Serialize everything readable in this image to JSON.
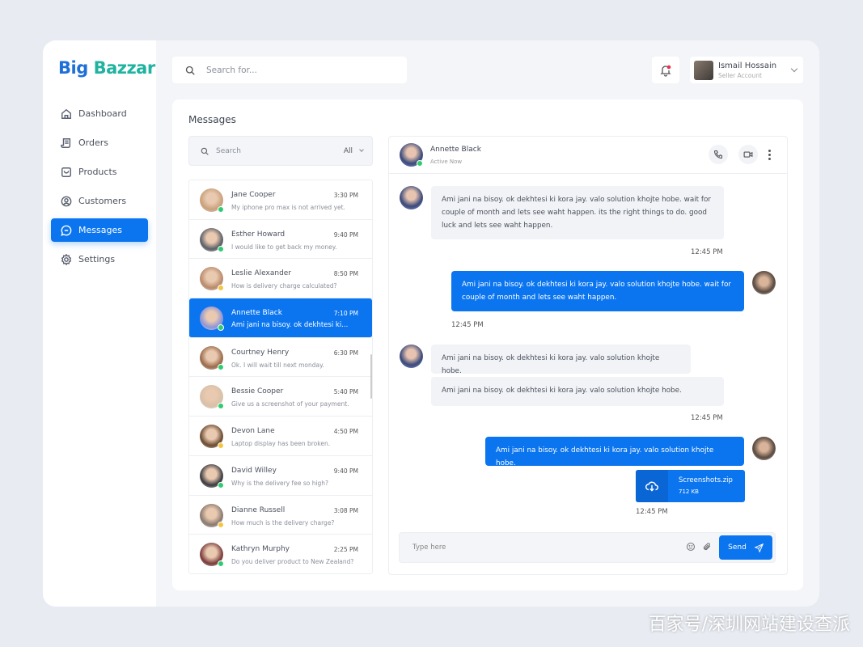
{
  "brand": {
    "part1": "Big",
    "part2": "Bazzar"
  },
  "sidebar": {
    "items": [
      {
        "label": "Dashboard",
        "icon": "home-icon"
      },
      {
        "label": "Orders",
        "icon": "receipt-icon"
      },
      {
        "label": "Products",
        "icon": "bag-icon"
      },
      {
        "label": "Customers",
        "icon": "user-circle-icon"
      },
      {
        "label": "Messages",
        "icon": "chat-icon",
        "active": true
      },
      {
        "label": "Settings",
        "icon": "gear-icon"
      }
    ]
  },
  "header": {
    "search_placeholder": "Search for...",
    "user": {
      "name": "Ismail Hossain",
      "role": "Seller Account"
    }
  },
  "messages": {
    "title": "Messages",
    "search_placeholder": "Search",
    "filter": "All",
    "conversations": [
      {
        "name": "Jane Cooper",
        "time": "3:30 PM",
        "preview": "My iphone pro max is not arrived yet.",
        "status": "online"
      },
      {
        "name": "Esther Howard",
        "time": "9:40 PM",
        "preview": "I would like to get back my money.",
        "status": "online"
      },
      {
        "name": "Leslie Alexander",
        "time": "8:50 PM",
        "preview": "How is delivery charge calculated?",
        "status": "away"
      },
      {
        "name": "Annette Black",
        "time": "7:10 PM",
        "preview": "Ami jani na bisoy. ok dekhtesi ki...",
        "status": "online",
        "active": true
      },
      {
        "name": "Courtney Henry",
        "time": "6:30 PM",
        "preview": "Ok. I will wait till next monday.",
        "status": "online"
      },
      {
        "name": "Bessie Cooper",
        "time": "5:40 PM",
        "preview": "Give us a screenshot of your payment.",
        "status": "online"
      },
      {
        "name": "Devon Lane",
        "time": "4:50 PM",
        "preview": "Laptop  display has been broken.",
        "status": "away"
      },
      {
        "name": "David Willey",
        "time": "9:40 PM",
        "preview": "Why is the delivery fee so high?",
        "status": "online"
      },
      {
        "name": "Dianne Russell",
        "time": "3:08 PM",
        "preview": "How much is the delivery charge?",
        "status": "away"
      },
      {
        "name": "Kathryn Murphy",
        "time": "2:25 PM",
        "preview": "Do you deliver product to New Zealand?",
        "status": "online"
      }
    ]
  },
  "chat": {
    "name": "Annette Black",
    "status": "Active Now",
    "messages": [
      {
        "text": "Ami jani na bisoy. ok dekhtesi ki kora jay. valo solution khojte hobe. wait for couple of month and lets see waht happen. its the right things to do. good luck and lets see waht happen."
      },
      {
        "time": "12:45 PM"
      },
      {
        "text": "Ami jani na bisoy. ok dekhtesi ki kora jay. valo solution khojte hobe. wait for couple of month and lets see waht happen."
      },
      {
        "time": "12:45 PM"
      },
      {
        "text": "Ami jani na bisoy. ok dekhtesi ki kora jay. valo solution khojte hobe."
      },
      {
        "text": "Ami jani na bisoy. ok dekhtesi ki kora jay. valo solution khojte hobe."
      },
      {
        "time": "12:45 PM"
      },
      {
        "text": "Ami jani na bisoy. ok dekhtesi ki kora jay. valo solution khojte hobe."
      },
      {
        "file": "Screenshots.zip",
        "size": "712 KB"
      },
      {
        "time": "12:45 PM"
      }
    ],
    "input_placeholder": "Type here",
    "send_label": "Send"
  },
  "colors": {
    "accent": "#0b75f0",
    "online": "#2ecc71",
    "away": "#f5c542"
  },
  "watermark": "百家号/深圳网站建设查派"
}
